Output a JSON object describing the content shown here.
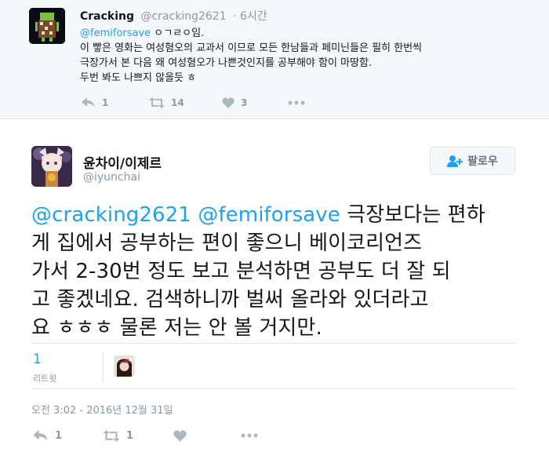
{
  "parent_tweet": {
    "name": "Cracking",
    "handle": "@cracking2621",
    "time": "6시간",
    "text_lines": [
      {
        "mention": "@femiforsave",
        "rest": " ㅇㄱㄹㅇ임."
      },
      {
        "text": "이 빻은 영화는 여성혐오의 교과서 이므로 모든 한남들과 페미닌들은 필히 한번씩"
      },
      {
        "text": "극장가서 본 다음 왜 여성혐오가 나쁜것인지를 공부해야 함이 마땅함."
      },
      {
        "text": "두번 봐도 나쁘지 않을듯 ㅎ"
      }
    ],
    "actions": {
      "reply": "1",
      "retweet": "14",
      "like": "3"
    }
  },
  "main_tweet": {
    "name": "윤차이/이제르",
    "handle": "@iyunchai",
    "follow_label": "팔로우",
    "line1_mention1": "@cracking2621",
    "line1_mention2": "@femiforsave",
    "line1_rest": " 극장보다는 편하",
    "lines": [
      "게 집에서 공부하는 편이 좋으니 베이코리언즈",
      "가서 2-30번 정도 보고 분석하면 공부도 더 잘 되",
      "고 좋겠네요. 검색하니까 벌써 올라와 있더라고",
      "요 ㅎㅎㅎ 물론 저는 안 볼 거지만."
    ],
    "retweet_count": "1",
    "retweet_label": "리트윗",
    "date": "오전 3:02 - 2016년 12월 31일",
    "actions": {
      "reply": "1",
      "retweet": "1"
    }
  },
  "colors": {
    "accent": "#1da1f2",
    "muted": "#8899a6",
    "icon": "#aab8c2"
  }
}
